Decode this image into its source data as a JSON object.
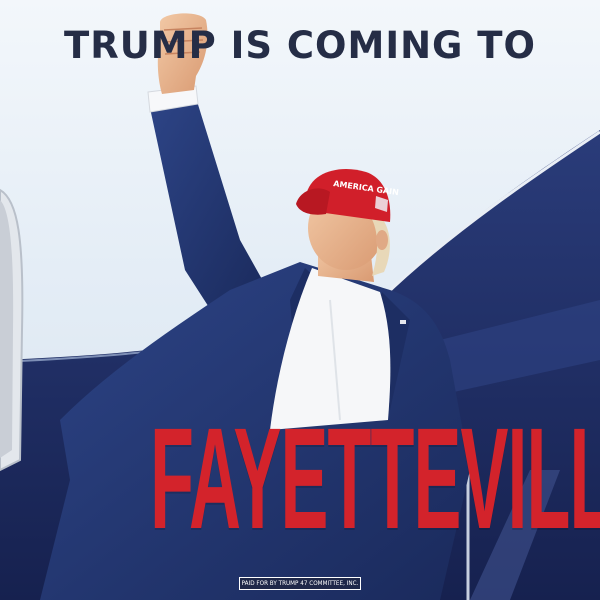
{
  "headline": "TRUMP IS COMING TO",
  "city": "FAYETTEVILLE, NC",
  "disclaimer": "PAID FOR BY TRUMP 47 COMMITTEE, INC.",
  "hat_text": "AMERICA GAIN",
  "colors": {
    "headline": "#252d46",
    "city": "#d3232b",
    "jet_blue": "#1f2f6a",
    "suit_blue": "#23376f",
    "hat_red": "#d11f2a",
    "sky": "#e4edf6"
  }
}
